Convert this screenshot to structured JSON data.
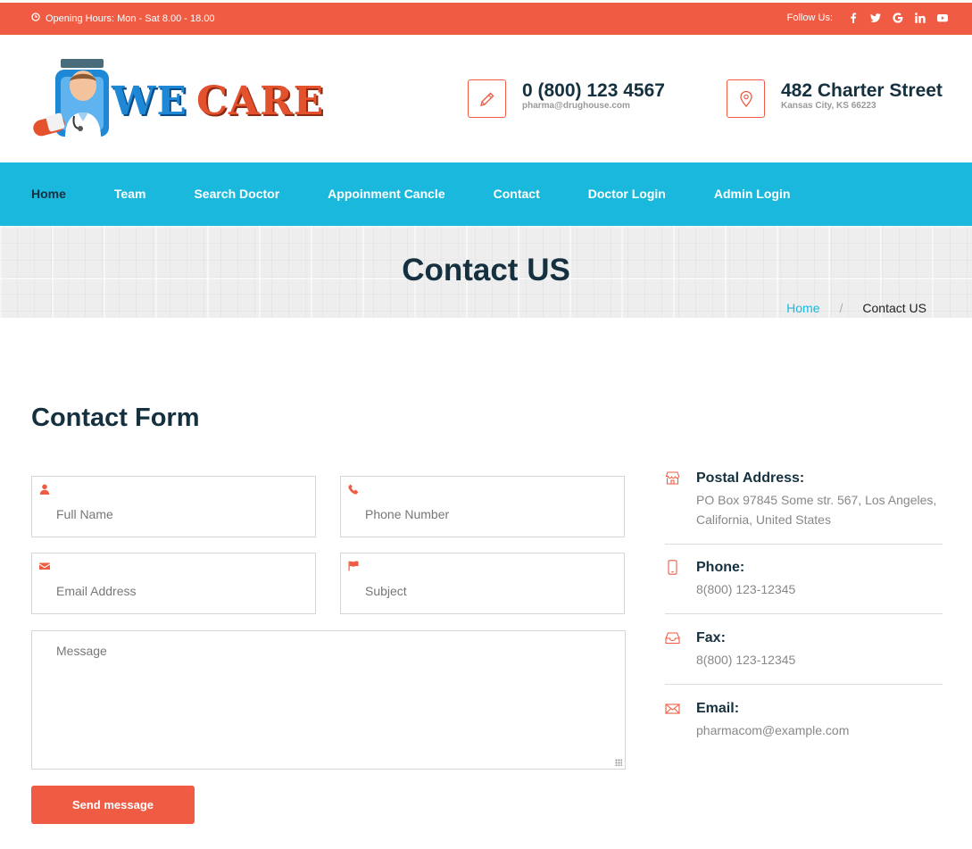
{
  "topbar": {
    "hours": "Opening Hours: Mon - Sat 8.00 - 18.00",
    "follow_label": "Follow Us:",
    "social": [
      "facebook-icon",
      "twitter-icon",
      "google-icon",
      "linkedin-icon",
      "youtube-icon"
    ]
  },
  "logo": {
    "word1": "WE",
    "word2": "CARE"
  },
  "header": {
    "phone": {
      "big": "0 (800) 123 4567",
      "small": "pharma@drughouse.com"
    },
    "address": {
      "big": "482 Charter Street",
      "small": "Kansas City, KS 66223"
    }
  },
  "nav": {
    "items": [
      "Home",
      "Team",
      "Search Doctor",
      "Appoinment Cancle",
      "Contact",
      "Doctor Login",
      "Admin Login"
    ]
  },
  "banner": {
    "title": "Contact US",
    "breadcrumb": {
      "home": "Home",
      "sep": "/",
      "current": "Contact US"
    }
  },
  "form": {
    "title": "Contact Form",
    "full_name_placeholder": "Full Name",
    "phone_placeholder": "Phone Number",
    "email_placeholder": "Email Address",
    "subject_placeholder": "Subject",
    "message_placeholder": "Message",
    "send_label": "Send message"
  },
  "contact_info": {
    "postal": {
      "title": "Postal Address:",
      "value": "PO Box 97845 Some str. 567, Los Angeles, California, United States"
    },
    "phone": {
      "title": "Phone:",
      "value": "8(800) 123-12345"
    },
    "fax": {
      "title": "Fax:",
      "value": "8(800) 123-12345"
    },
    "email": {
      "title": "Email:",
      "value": "pharmacom@example.com"
    }
  },
  "colors": {
    "accent": "#ef5c43",
    "nav": "#1ab8dc",
    "heading": "#15303f"
  }
}
